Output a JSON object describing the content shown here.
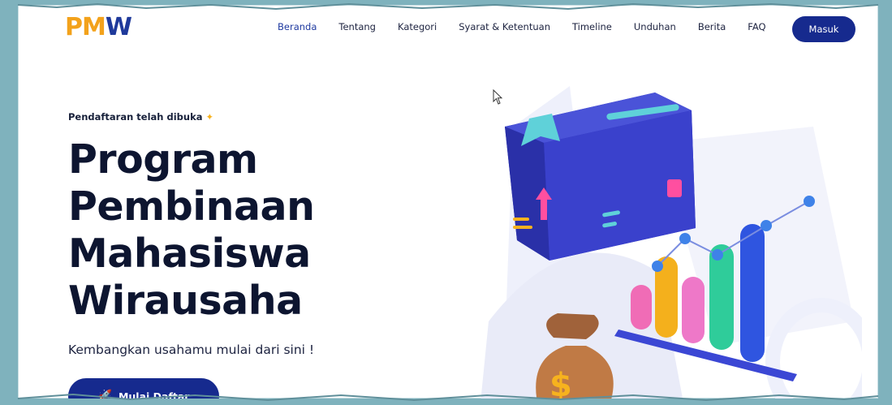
{
  "logo": {
    "text_a": "PM",
    "text_b": "W"
  },
  "nav": {
    "items": [
      {
        "label": "Beranda",
        "active": true
      },
      {
        "label": "Tentang"
      },
      {
        "label": "Kategori"
      },
      {
        "label": "Syarat & Ketentuan"
      },
      {
        "label": "Timeline"
      },
      {
        "label": "Unduhan"
      },
      {
        "label": "Berita"
      },
      {
        "label": "FAQ"
      }
    ],
    "login_label": "Masuk"
  },
  "hero": {
    "eyebrow": "Pendaftaran telah dibuka",
    "title_lines": [
      "Program",
      "Pembinaan",
      "Mahasiswa",
      "Wirausaha"
    ],
    "subtitle": "Kembangkan usahamu mulai dari sini !",
    "cta_label": "Mulai Daftar"
  },
  "colors": {
    "primary": "#162a8e",
    "accent": "#f3a21b",
    "background": "#7fb2bd"
  },
  "icons": {
    "eyebrow": "sparkle-icon",
    "cta": "rocket-icon"
  }
}
